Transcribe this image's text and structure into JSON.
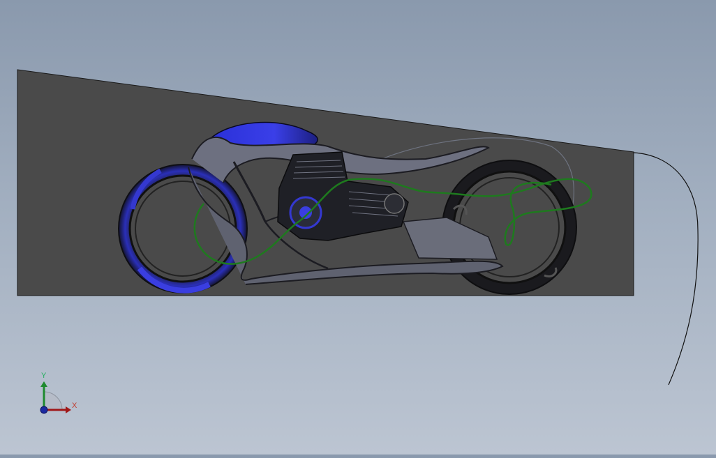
{
  "triad": {
    "x_label": "X",
    "y_label": "Y",
    "x_color": "#a01818",
    "y_color": "#1e8a2e",
    "z_color": "#1c2aa0"
  },
  "scene": {
    "sketch_plane_color": "#4a4a4a",
    "accent_color": "#2b2fd6",
    "curve_color": "#1e7a1e"
  },
  "icons": [
    "coordinate-triad-icon"
  ]
}
